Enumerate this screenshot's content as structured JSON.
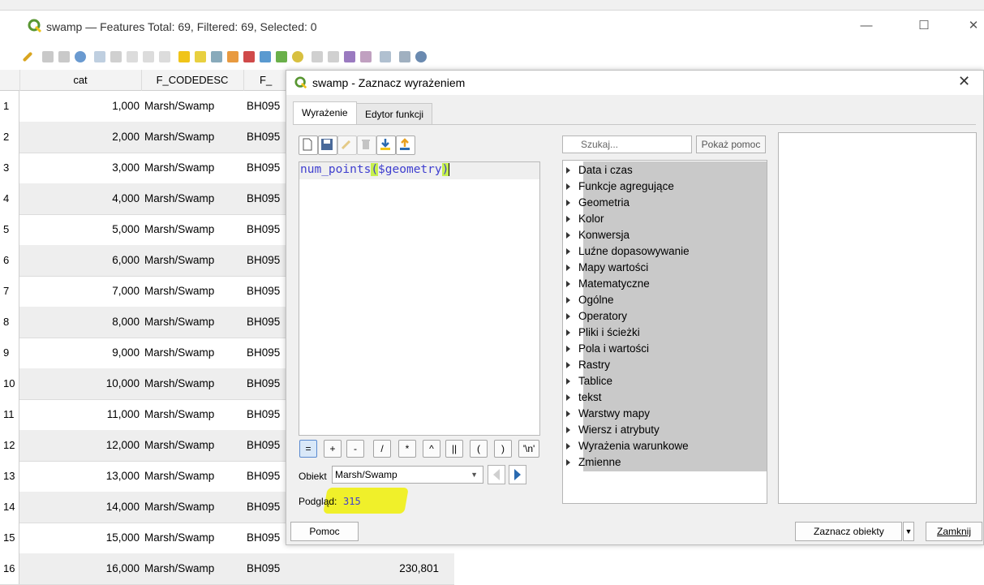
{
  "window": {
    "title": "swamp — Features Total: 69, Filtered: 69, Selected: 0"
  },
  "table": {
    "columns": [
      "cat",
      "F_CODEDESC",
      "F_"
    ],
    "rows": [
      {
        "num": "1",
        "cat": "1,000",
        "desc": "Marsh/Swamp",
        "code": "BH095"
      },
      {
        "num": "2",
        "cat": "2,000",
        "desc": "Marsh/Swamp",
        "code": "BH095"
      },
      {
        "num": "3",
        "cat": "3,000",
        "desc": "Marsh/Swamp",
        "code": "BH095"
      },
      {
        "num": "4",
        "cat": "4,000",
        "desc": "Marsh/Swamp",
        "code": "BH095"
      },
      {
        "num": "5",
        "cat": "5,000",
        "desc": "Marsh/Swamp",
        "code": "BH095"
      },
      {
        "num": "6",
        "cat": "6,000",
        "desc": "Marsh/Swamp",
        "code": "BH095"
      },
      {
        "num": "7",
        "cat": "7,000",
        "desc": "Marsh/Swamp",
        "code": "BH095"
      },
      {
        "num": "8",
        "cat": "8,000",
        "desc": "Marsh/Swamp",
        "code": "BH095"
      },
      {
        "num": "9",
        "cat": "9,000",
        "desc": "Marsh/Swamp",
        "code": "BH095"
      },
      {
        "num": "10",
        "cat": "10,000",
        "desc": "Marsh/Swamp",
        "code": "BH095"
      },
      {
        "num": "11",
        "cat": "11,000",
        "desc": "Marsh/Swamp",
        "code": "BH095"
      },
      {
        "num": "12",
        "cat": "12,000",
        "desc": "Marsh/Swamp",
        "code": "BH095"
      },
      {
        "num": "13",
        "cat": "13,000",
        "desc": "Marsh/Swamp",
        "code": "BH095"
      },
      {
        "num": "14",
        "cat": "14,000",
        "desc": "Marsh/Swamp",
        "code": "BH095"
      },
      {
        "num": "15",
        "cat": "15,000",
        "desc": "Marsh/Swamp",
        "code": "BH095"
      },
      {
        "num": "16",
        "cat": "16,000",
        "desc": "Marsh/Swamp",
        "code": "BH095"
      }
    ],
    "last_row_extra": "230,801"
  },
  "dialog": {
    "title": "swamp - Zaznacz wyrażeniem",
    "tabs": [
      "Wyrażenie",
      "Edytor funkcji"
    ],
    "expression": {
      "func": "num_points",
      "open": "(",
      "arg": "$geometry",
      "close": ")"
    },
    "operators": [
      "=",
      "+",
      "-",
      "/",
      "*",
      "^",
      "||",
      "(",
      ")",
      "'\\n'"
    ],
    "object_label": "Obiekt",
    "object_value": "Marsh/Swamp",
    "preview_label": "Podgląd:",
    "preview_value": "315",
    "search_placeholder": "Szukaj...",
    "help_button": "Pokaż pomoc",
    "functions": [
      "Data i czas",
      "Funkcje agregujące",
      "Geometria",
      "Kolor",
      "Konwersja",
      "Luźne dopasowywanie",
      "Mapy wartości",
      "Matematyczne",
      "Ogólne",
      "Operatory",
      "Pliki i ścieżki",
      "Pola i wartości",
      "Rastry",
      "Tablice",
      "tekst",
      "Warstwy mapy",
      "Wiersz i atrybuty",
      "Wyrażenia warunkowe",
      "Zmienne"
    ],
    "btn_help": "Pomoc",
    "btn_select": "Zaznacz obiekty",
    "btn_close": "Zamknij"
  },
  "colors": {
    "qgis_green": "#589632",
    "highlight_yellow": "#f0f02a",
    "expr_blue": "#3f3fcf"
  }
}
